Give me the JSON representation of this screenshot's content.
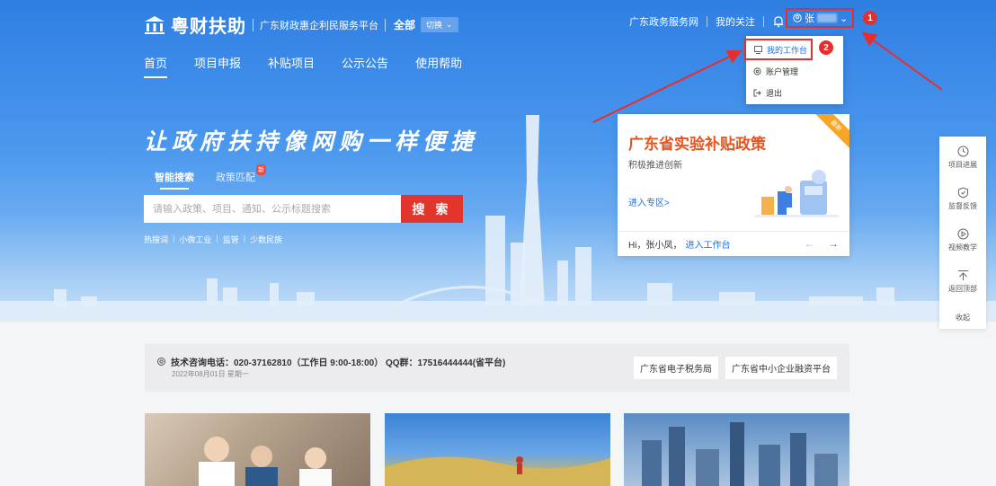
{
  "header": {
    "brand": "粤财扶助",
    "subtitle": "广东财政惠企利民服务平台",
    "region": "全部",
    "switch_label": "切换",
    "links": [
      "广东政务服务网",
      "我的关注"
    ],
    "user_name": "张"
  },
  "nav": {
    "items": [
      {
        "label": "首页",
        "active": true
      },
      {
        "label": "项目申报",
        "active": false
      },
      {
        "label": "补贴项目",
        "active": false
      },
      {
        "label": "公示公告",
        "active": false
      },
      {
        "label": "使用帮助",
        "active": false
      }
    ]
  },
  "user_menu": {
    "items": [
      {
        "label": "我的工作台",
        "icon": "monitor-icon"
      },
      {
        "label": "账户管理",
        "icon": "gear-icon"
      },
      {
        "label": "退出",
        "icon": "logout-icon"
      }
    ]
  },
  "annotations": {
    "badge1": "1",
    "badge2": "2",
    "color": "#e62e2e"
  },
  "hero": {
    "slogan": "让政府扶持像网购一样便捷",
    "search_tabs": [
      "智能搜索",
      "政策匹配"
    ],
    "new_tag": "新",
    "search_placeholder": "请输入政策、项目、通知、公示标题搜索",
    "search_button": "搜 索",
    "hot_label": "热搜词",
    "hot_words": [
      "小微工业",
      "监管",
      "少数民族"
    ]
  },
  "policy_card": {
    "title": "广东省实验补贴政策",
    "subtitle": "积极推进创新",
    "link": "进入专区>",
    "ribbon": "最新",
    "greeting": "Hi，张小凤，",
    "enter_workbench": "进入工作台",
    "prev": "←",
    "next": "→"
  },
  "sidebar": {
    "items": [
      {
        "label": "项目进展",
        "icon": "clock-icon"
      },
      {
        "label": "监督反馈",
        "icon": "shield-icon"
      },
      {
        "label": "视频教学",
        "icon": "play-icon"
      },
      {
        "label": "返回顶部",
        "icon": "arrow-up-icon"
      }
    ],
    "collapse": "收起"
  },
  "contact": {
    "phone_line": "技术咨询电话：020-37162810（工作日 9:00-18:00） QQ群：17516444444(省平台)",
    "date": "2022年08月01日 星期一",
    "buttons": [
      "广东省电子税务局",
      "广东省中小企业融资平台"
    ]
  },
  "colors": {
    "primary": "#2f7fe3",
    "accent_red": "#e2352e",
    "link_blue": "#1f6fe0",
    "card_title": "#e8541e"
  }
}
